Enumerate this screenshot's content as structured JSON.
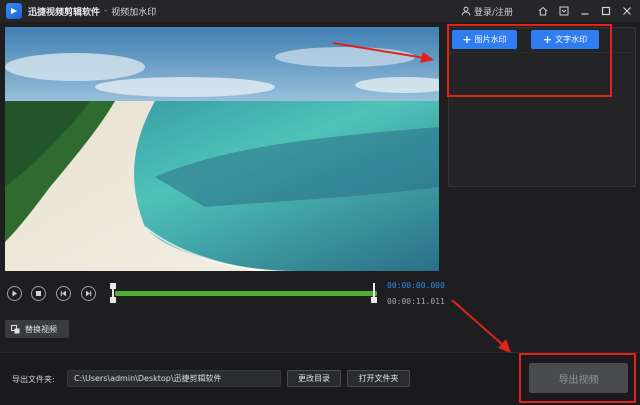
{
  "titlebar": {
    "app_name": "迅捷视频剪辑软件",
    "separator": "-",
    "page_name": "视频加水印",
    "login_label": "登录/注册",
    "icons": [
      "user-icon",
      "home-icon",
      "settings-icon",
      "minimize-icon",
      "maximize-icon",
      "close-icon"
    ]
  },
  "player": {
    "current_time": "00:00:00.000",
    "total_time": "00:00:11.011",
    "controls": [
      "play-icon",
      "stop-icon",
      "previous-icon",
      "next-icon"
    ],
    "replace_label": "替换视频"
  },
  "watermark_panel": {
    "image_watermark_label": "图片水印",
    "text_watermark_label": "文字水印"
  },
  "bottom_bar": {
    "output_label": "导出文件夹:",
    "output_path": "C:\\Users\\admin\\Desktop\\迅捷剪辑软件",
    "change_dir_label": "更改目录",
    "open_folder_label": "打开文件夹",
    "export_label": "导出视频"
  },
  "colors": {
    "accent": "#2f7df0",
    "timeline": "#4caf2d",
    "annotation": "#e2231a",
    "background": "#1e1e20"
  }
}
